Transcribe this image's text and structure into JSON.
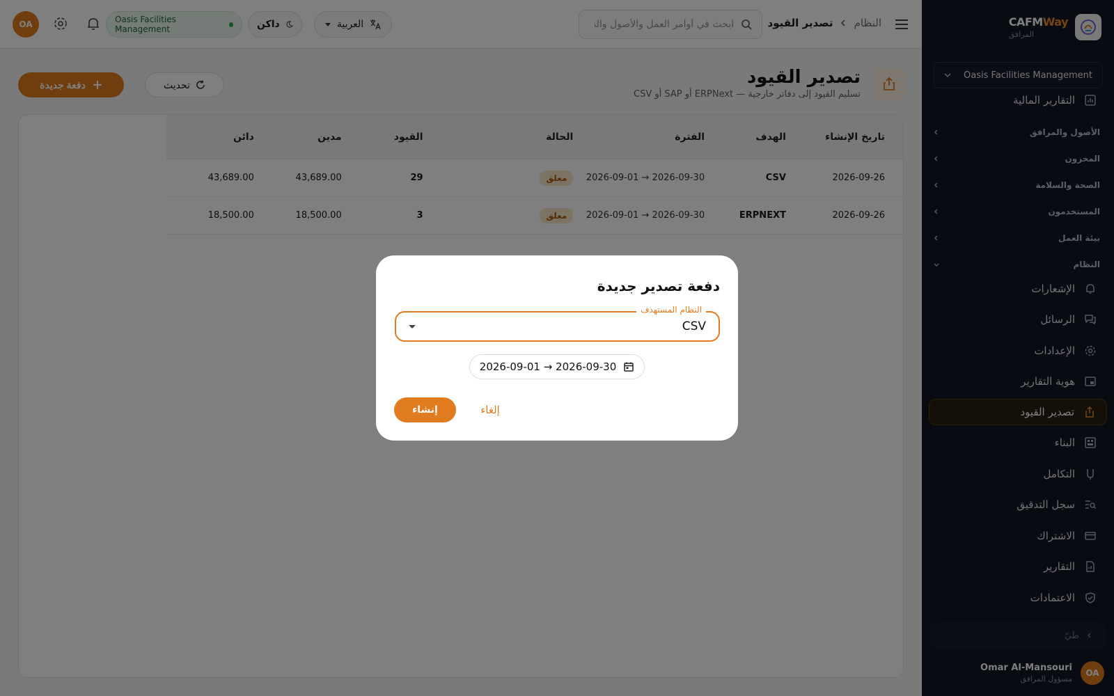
{
  "brand": {
    "name_part1": "CAFM",
    "name_part2": "Way",
    "subtitle": "المرافق"
  },
  "sidebar": {
    "org_select": "Oasis Facilities Management",
    "top_item": "التقارير المالية",
    "groups": [
      "الأصول والمرافق",
      "المخزون",
      "الصحة والسلامة",
      "المستخدمون",
      "بيئة العمل",
      "النظام"
    ],
    "items": [
      {
        "label": "الإشعارات",
        "icon": "bell-icon"
      },
      {
        "label": "الرسائل",
        "icon": "messages-icon"
      },
      {
        "label": "الإعدادات",
        "icon": "gear-icon"
      },
      {
        "label": "هوية التقارير",
        "icon": "branding-icon"
      },
      {
        "label": "تصدير القيود",
        "icon": "export-icon",
        "active": true
      },
      {
        "label": "البناء",
        "icon": "builder-icon"
      },
      {
        "label": "التكامل",
        "icon": "integration-icon"
      },
      {
        "label": "سجل التدقيق",
        "icon": "audit-icon"
      },
      {
        "label": "الاشتراك",
        "icon": "card-icon"
      },
      {
        "label": "التقارير",
        "icon": "report-icon"
      },
      {
        "label": "الاعتمادات",
        "icon": "shield-check-icon"
      }
    ],
    "collapse_label": "طيّ",
    "user": {
      "initials": "OA",
      "name": "Omar Al-Mansouri",
      "role": "مسؤول المرافق"
    }
  },
  "topbar": {
    "breadcrumb_parent": "النظام",
    "breadcrumb_current": "تصدير القيود",
    "search_placeholder": "ابحث في أوامر العمل والأصول والت...",
    "language": "العربية",
    "theme": "داكن",
    "org_badge": "Oasis Facilities Management",
    "avatar_initials": "OA"
  },
  "page": {
    "title": "تصدير القيود",
    "subtitle": "تسليم القيود إلى دفاتر خارجية — ERPNext أو SAP أو CSV",
    "new_batch_label": "دفعة جديدة",
    "refresh_label": "تحديث"
  },
  "table": {
    "columns": [
      "تاريخ الإنشاء",
      "الهدف",
      "الفترة",
      "الحالة",
      "القيود",
      "مدين",
      "دائن"
    ],
    "rows": [
      {
        "created": "2026-09-26",
        "target": "CSV",
        "period": "2026-09-01 → 2026-09-30",
        "status": "معلق",
        "entries": "29",
        "debit": "43,689.00",
        "credit": "43,689.00"
      },
      {
        "created": "2026-09-26",
        "target": "ERPNEXT",
        "period": "2026-09-01 → 2026-09-30",
        "status": "معلق",
        "entries": "3",
        "debit": "18,500.00",
        "credit": "18,500.00"
      }
    ]
  },
  "modal": {
    "title": "دفعة تصدير جديدة",
    "target_label": "النظام المستهدف",
    "target_value": "CSV",
    "date_range": "2026-09-01 → 2026-09-30",
    "create_label": "إنشاء",
    "cancel_label": "إلغاء"
  },
  "colors": {
    "accent": "#e07b1f",
    "sidebar_bg": "#101622",
    "status_pending_bg": "#fbe6c8"
  }
}
